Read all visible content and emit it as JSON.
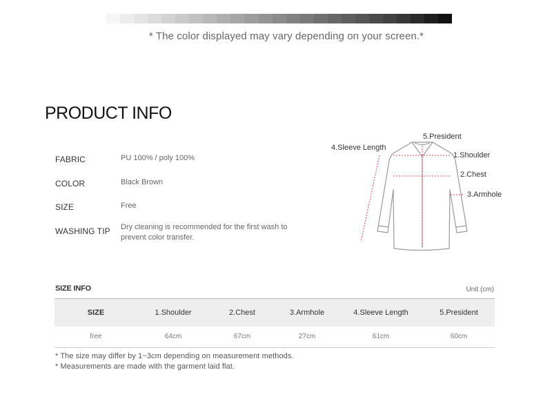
{
  "color_note": "* The color displayed may vary depending on your screen.*",
  "gradient_colors": [
    "#f6f6f6",
    "#ededed",
    "#e5e5e5",
    "#dcdcdc",
    "#d3d3d3",
    "#cacaca",
    "#c1c1c1",
    "#b8b8b8",
    "#afafaf",
    "#a6a6a6",
    "#9d9d9d",
    "#949494",
    "#8b8b8b",
    "#828282",
    "#797979",
    "#707070",
    "#676767",
    "#5e5e5e",
    "#555555",
    "#4b4b4b",
    "#424242",
    "#373737",
    "#2b2b2b",
    "#1e1e1e",
    "#111111"
  ],
  "section_title": "PRODUCT INFO",
  "specs": {
    "fabric": {
      "label": "FABRIC",
      "value": "PU 100% / poly 100%"
    },
    "color": {
      "label": "COLOR",
      "value": "Black Brown"
    },
    "size": {
      "label": "SIZE",
      "value": "Free"
    },
    "washing": {
      "label": "WASHING TIP",
      "value": "Dry cleaning is recommended for the first wash to prevent color transfer."
    }
  },
  "diagram_labels": {
    "president": "5.President",
    "sleeve": "4.Sleeve Length",
    "shoulder": "1.Shoulder",
    "chest": "2.Chest",
    "armhole": "3.Armhole"
  },
  "size_info": {
    "title": "SIZE INFO",
    "unit": "Unit (cm)",
    "headers": [
      "SIZE",
      "1.Shoulder",
      "2.Chest",
      "3.Armhole",
      "4.Sleeve Length",
      "5.President"
    ],
    "row": [
      "free",
      "64cm",
      "67cm",
      "27cm",
      "61cm",
      "60cm"
    ]
  },
  "footnotes": [
    "* The size may differ by 1~3cm depending on measurement methods.",
    "* Measurements are made with the garment laid flat."
  ]
}
